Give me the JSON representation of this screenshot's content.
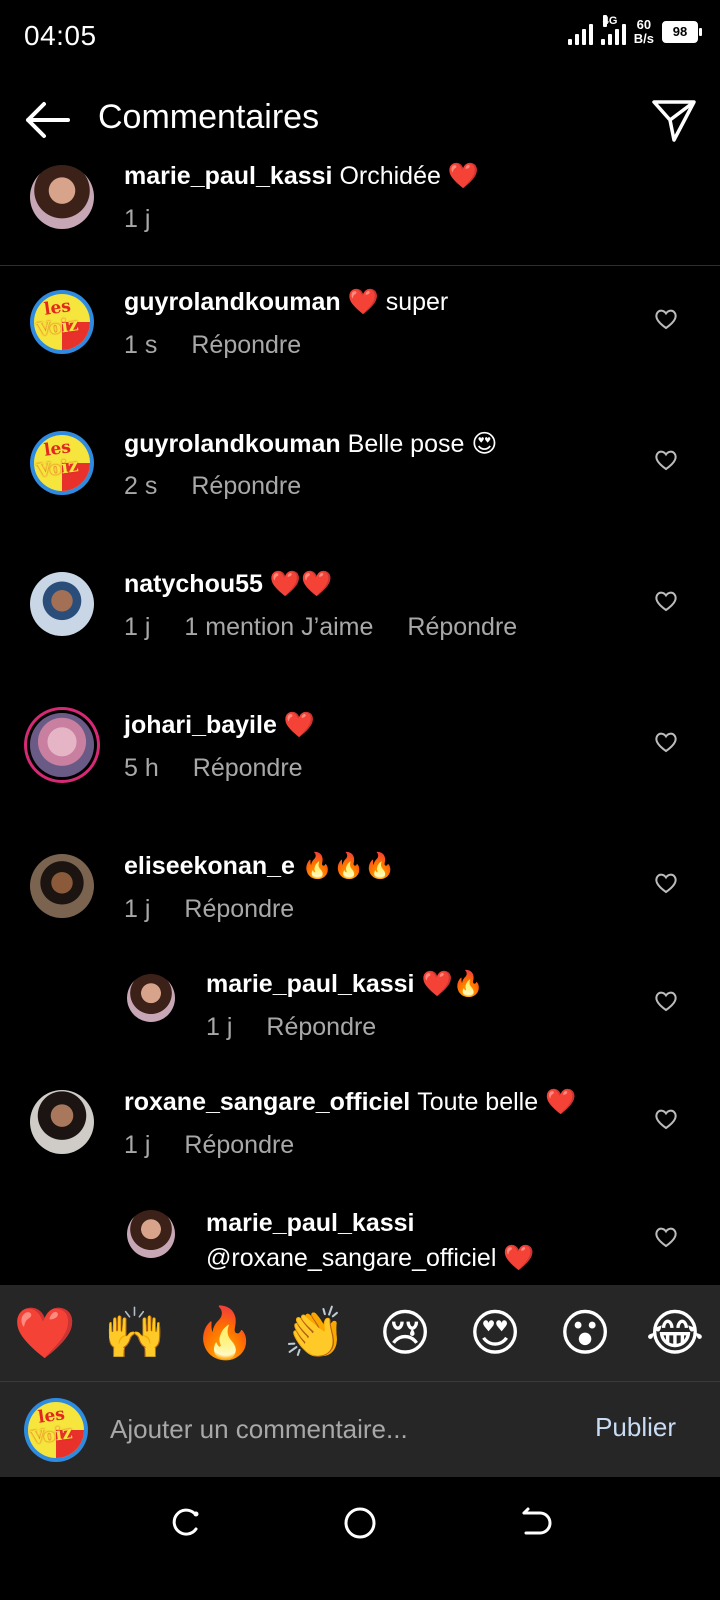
{
  "status_bar": {
    "time": "04:05",
    "network": "4G",
    "speed_value": "60",
    "speed_unit": "B/s",
    "battery": "98"
  },
  "header": {
    "title": "Commentaires"
  },
  "pinned": {
    "username": "marie_paul_kassi",
    "text": "Orchidée ❤️",
    "time": "1 j"
  },
  "comments": [
    {
      "username": "guyrolandkouman",
      "text": "❤️ super",
      "time": "1 s",
      "reply": "Répondre"
    },
    {
      "username": "guyrolandkouman",
      "text": "Belle pose 😍",
      "time": "2 s",
      "reply": "Répondre"
    },
    {
      "username": "natychou55",
      "text": "❤️❤️",
      "time": "1 j",
      "likes": "1 mention J’aime",
      "reply": "Répondre"
    },
    {
      "username": "johari_bayile",
      "text": "❤️",
      "time": "5 h",
      "reply": "Répondre"
    },
    {
      "username": "eliseekonan_e",
      "text": "🔥🔥🔥",
      "time": "1 j",
      "reply": "Répondre"
    },
    {
      "username": "marie_paul_kassi",
      "text": "❤️🔥",
      "time": "1 j",
      "reply": "Répondre"
    },
    {
      "username": "roxane_sangare_officiel",
      "text": "Toute belle ❤️",
      "time": "1 j",
      "reply": "Répondre"
    },
    {
      "username": "marie_paul_kassi",
      "text": "@roxane_sangare_officiel ❤️"
    }
  ],
  "emoji_bar": [
    "❤️",
    "🙌",
    "🔥",
    "👏",
    "😢",
    "😍",
    "😮",
    "😂"
  ],
  "logo": {
    "line1": "les",
    "line2": "Voiz"
  },
  "composer": {
    "placeholder": "Ajouter un commentaire...",
    "publish": "Publier"
  },
  "colors": {
    "background": "#000000",
    "muted_text": "#a8a8a8",
    "publish": "#c8dcf4",
    "heart": "#e8302f",
    "panel": "#262626"
  }
}
